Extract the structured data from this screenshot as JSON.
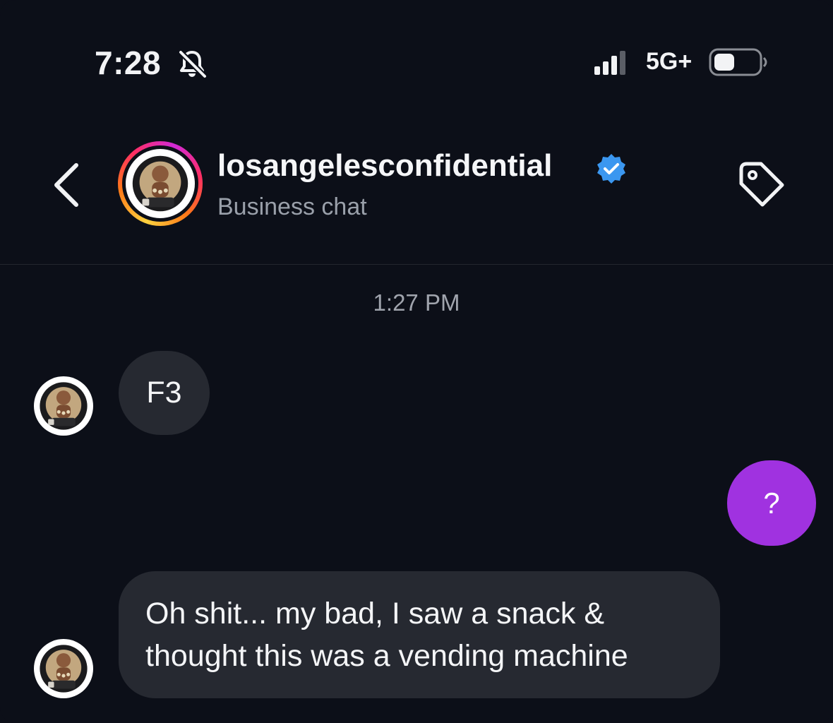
{
  "status_bar": {
    "time": "7:28",
    "network": "5G+",
    "icons": [
      "bell-slash-icon",
      "signal-icon",
      "battery-icon"
    ]
  },
  "header": {
    "username": "losangelesconfidential",
    "subtitle": "Business chat",
    "verified": true,
    "icons": [
      "back-chevron-icon",
      "verified-badge-icon",
      "tag-icon"
    ],
    "colors": {
      "verified": "#3b97f0",
      "story_ring": [
        "#ffd23f",
        "#ff2e63",
        "#d12ad6"
      ]
    }
  },
  "conversation": {
    "timestamp": "1:27 PM",
    "messages": [
      {
        "sender": "them",
        "text": "F3"
      },
      {
        "sender": "me",
        "text": "?"
      },
      {
        "sender": "them",
        "text": "Oh shit... my bad, I saw a snack & thought this was a vending machine"
      }
    ],
    "colors": {
      "incoming_bubble": "#262931",
      "outgoing_bubble": "#a032e0",
      "background": "#0c0f18"
    }
  }
}
